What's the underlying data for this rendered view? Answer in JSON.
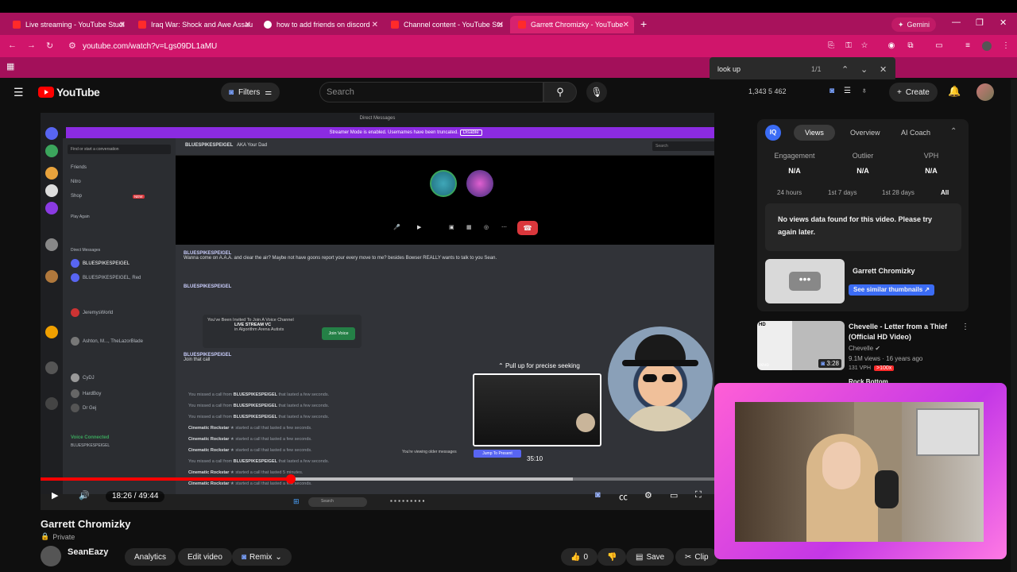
{
  "browser": {
    "tabs": [
      {
        "title": "Live streaming - YouTube Studi"
      },
      {
        "title": "Iraq War: Shock and Awe Assau"
      },
      {
        "title": "how to add friends on discord"
      },
      {
        "title": "Channel content - YouTube Stu"
      },
      {
        "title": "Garrett Chromizky - YouTube"
      }
    ],
    "new_tab": "+",
    "gemini": "Gemini",
    "url": "youtube.com/watch?v=Lgs09DL1aMU",
    "find": {
      "query": "look up",
      "count": "1/1"
    }
  },
  "youtube": {
    "brand": "YouTube",
    "filters": "Filters",
    "search_placeholder": "Search",
    "stats": "1,343  5  462",
    "create": "Create"
  },
  "discord": {
    "title": "Direct Messages",
    "streamer_banner": "Streamer Mode is enabled. Usernames have been truncated.",
    "disable": "Disable",
    "find": "Find or start a conversation",
    "nav": [
      "Friends",
      "Nitro",
      "Shop"
    ],
    "new_badge": "NEW",
    "direct_messages": "Direct Messages",
    "play_again": "Play Again",
    "dm_list": [
      "BLUESPIKESPEIGEL",
      "BLUESPIKESPEIGEL, Red",
      "JeremysWorld",
      "Ashton, M..., TheLazorBlade",
      "CyDJ",
      "HardBoy",
      "Dr Gej"
    ],
    "voice_connected": "Voice Connected",
    "voice_sub": "BLUESPIKESPEIGEL",
    "header_name": "BLUESPIKESPEIGEL",
    "header_aka": "AKA",
    "header_nick": "Your Dad",
    "search": "Search",
    "msg1_name": "BLUESPIKESPEIGEL",
    "msg1_text": "Wanna come on A.A.A. and clear the air? Maybe not have goons report your every move to me? besides Bowser REALLY wants to talk to you Sean.",
    "msg2_name": "BLUESPIKESPEIGEL",
    "invite_title": "You've Been Invited To Join A Voice Channel",
    "invite_channel": "LIVE STREAM VC",
    "invite_sub": "in Algorithm Arena Autists",
    "join_voice": "Join Voice",
    "msg3_name": "BLUESPIKESPEIGEL",
    "msg3_text": "Join that call",
    "calls": [
      {
        "who": "BLUESPIKESPEIGEL",
        "text": "that lasted a few seconds."
      },
      {
        "who": "BLUESPIKESPEIGEL",
        "text": "that lasted a few seconds."
      },
      {
        "who": "BLUESPIKESPEIGEL",
        "text": "that lasted a few seconds."
      },
      {
        "who": "Cinematic Rockstar",
        "text": "started a call that lasted a few seconds."
      },
      {
        "who": "Cinematic Rockstar",
        "text": "started a call that lasted a few seconds."
      },
      {
        "who": "Cinematic Rockstar",
        "text": "started a call that lasted a few seconds."
      },
      {
        "who": "BLUESPIKESPEIGEL",
        "text": "that lasted a few seconds."
      },
      {
        "who": "Cinematic Rockstar",
        "text": "started a call that lasted 5 minutes."
      },
      {
        "who": "Cinematic Rockstar",
        "text": "started a call that lasted a few seconds."
      }
    ],
    "missed_prefix": "You missed a call from",
    "older": "You're viewing older messages",
    "jump": "Jump To Present",
    "taskbar_search": "Search"
  },
  "player": {
    "seek_hint": "Pull up for precise seeking",
    "hover_time": "35:10",
    "time": "18:26 / 49:44",
    "played_fraction": 0.371,
    "buffered_fraction": 0.79
  },
  "video": {
    "title": "Garrett Chromizky",
    "visibility": "Private",
    "channel": "SeanEazy",
    "actions": {
      "analytics": "Analytics",
      "edit": "Edit video",
      "remix": "Remix",
      "likes": "0",
      "save": "Save",
      "clip": "Clip"
    }
  },
  "vidiq": {
    "logo": "IQ",
    "tabs": [
      "Views",
      "Overview",
      "AI Coach"
    ],
    "metrics": [
      {
        "label": "Engagement",
        "value": "N/A"
      },
      {
        "label": "Outlier",
        "value": "N/A"
      },
      {
        "label": "VPH",
        "value": "N/A"
      }
    ],
    "ranges": [
      "24 hours",
      "1st 7 days",
      "1st 28 days",
      "All"
    ],
    "no_data": "No views data found for this video. Please try again later.",
    "thumb_title": "Garrett Chromizky",
    "similar": "See similar thumbnails"
  },
  "recommendations": [
    {
      "title": "Chevelle - Letter from a Thief (Official HD Video)",
      "channel": "Chevelle",
      "meta": "9.1M views · 16 years ago",
      "vph": "131 VPH",
      "badge": ">100x",
      "duration": "3:28",
      "hd": "HD",
      "vevo": "vevo"
    },
    {
      "title": "Rock Bottom"
    }
  ],
  "colors": {
    "yt_red": "#ff0000",
    "browser_pink": "#d0156b",
    "discord_purple": "#8b2be2",
    "iq_blue": "#3b6cf5"
  }
}
